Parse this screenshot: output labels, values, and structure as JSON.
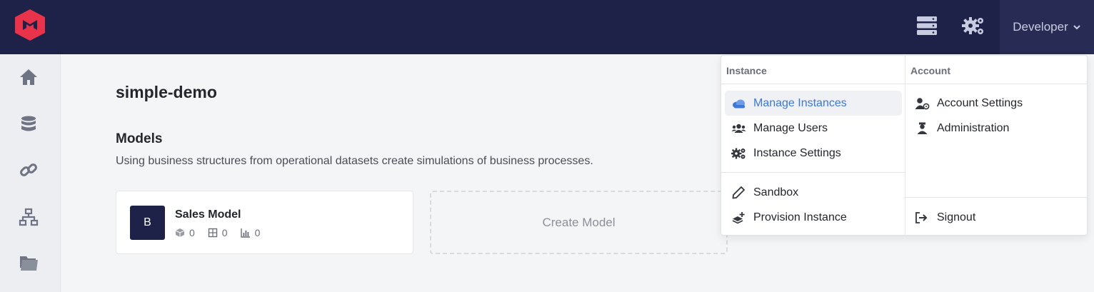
{
  "topbar": {
    "user_menu_label": "Developer",
    "icons": [
      "logo-icon",
      "servers-icon",
      "settings-gears-icon",
      "chevron-down-icon"
    ]
  },
  "sidebar": {
    "items": [
      {
        "icon": "home-icon"
      },
      {
        "icon": "database-icon"
      },
      {
        "icon": "link-icon"
      },
      {
        "icon": "network-icon"
      },
      {
        "icon": "folder-icon"
      }
    ]
  },
  "main": {
    "title": "simple-demo",
    "section_title": "Models",
    "description": "Using business structures from operational datasets create simulations of business processes.",
    "model_card": {
      "avatar_letter": "B",
      "name": "Sales Model",
      "stats": [
        {
          "icon": "cube-icon",
          "value": "0"
        },
        {
          "icon": "grid-icon",
          "value": "0"
        },
        {
          "icon": "bar-chart-icon",
          "value": "0"
        }
      ]
    },
    "create_label": "Create Model"
  },
  "dropdown": {
    "instance_header": "Instance",
    "account_header": "Account",
    "instance_items": [
      {
        "label": "Manage Instances",
        "icon": "cloud-icon",
        "active": true
      },
      {
        "label": "Manage Users",
        "icon": "users-icon"
      },
      {
        "label": "Instance Settings",
        "icon": "gears-icon"
      },
      {
        "label": "Sandbox",
        "icon": "pencil-icon"
      },
      {
        "label": "Provision Instance",
        "icon": "layers-plus-icon"
      }
    ],
    "account_items": [
      {
        "label": "Account Settings",
        "icon": "user-cog-icon"
      },
      {
        "label": "Administration",
        "icon": "admin-icon"
      },
      {
        "label": "Signout",
        "icon": "signout-icon"
      }
    ],
    "active_color": "#3c78d8"
  },
  "colors": {
    "topbar": "#1f2248",
    "brand": "#e8334a"
  }
}
